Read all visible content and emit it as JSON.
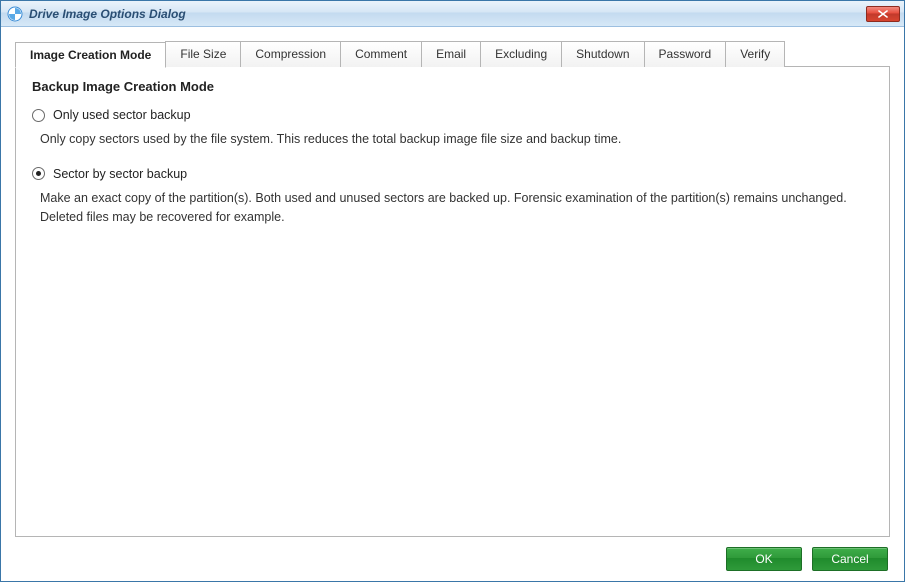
{
  "window": {
    "title": "Drive Image Options Dialog"
  },
  "tabs": {
    "t0": "Image Creation Mode",
    "t1": "File Size",
    "t2": "Compression",
    "t3": "Comment",
    "t4": "Email",
    "t5": "Excluding",
    "t6": "Shutdown",
    "t7": "Password",
    "t8": "Verify"
  },
  "panel": {
    "heading": "Backup Image Creation Mode",
    "option1": {
      "label": "Only used sector backup",
      "description": "Only copy sectors used by the file system. This reduces the total backup image file size and backup time.",
      "selected": false
    },
    "option2": {
      "label": "Sector by sector backup",
      "description": "Make an exact copy of the partition(s). Both used and unused sectors are backed up. Forensic examination of the partition(s) remains unchanged. Deleted files may be recovered for example.",
      "selected": true
    }
  },
  "buttons": {
    "ok": "OK",
    "cancel": "Cancel"
  }
}
